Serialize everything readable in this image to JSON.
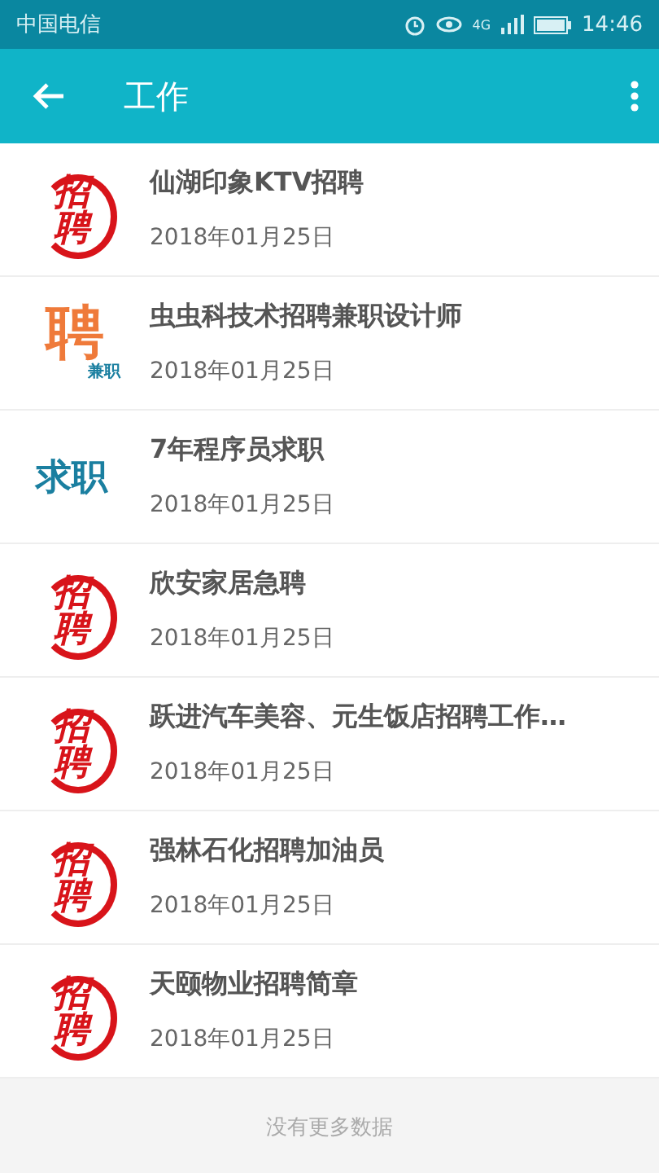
{
  "status_bar": {
    "carrier": "中国电信",
    "network": "4G",
    "time": "14:46"
  },
  "toolbar": {
    "title": "工作"
  },
  "jobs": [
    {
      "title": "仙湖印象KTV招聘",
      "date": "2018年01月25日",
      "thumb": {
        "kind": "red",
        "text": "招聘"
      }
    },
    {
      "title": "虫虫科技术招聘兼职设计师",
      "date": "2018年01月25日",
      "thumb": {
        "kind": "orange",
        "text": "聘",
        "sub": "兼职"
      }
    },
    {
      "title": "7年程序员求职",
      "date": "2018年01月25日",
      "thumb": {
        "kind": "blue",
        "text": "求职"
      }
    },
    {
      "title": "欣安家居急聘",
      "date": "2018年01月25日",
      "thumb": {
        "kind": "red",
        "text": "招聘"
      }
    },
    {
      "title": "跃进汽车美容、元生饭店招聘工作…",
      "date": "2018年01月25日",
      "thumb": {
        "kind": "red",
        "text": "招聘"
      }
    },
    {
      "title": "强林石化招聘加油员",
      "date": "2018年01月25日",
      "thumb": {
        "kind": "red",
        "text": "招聘"
      }
    },
    {
      "title": "天颐物业招聘简章",
      "date": "2018年01月25日",
      "thumb": {
        "kind": "red",
        "text": "招聘"
      }
    }
  ],
  "footer": "没有更多数据"
}
